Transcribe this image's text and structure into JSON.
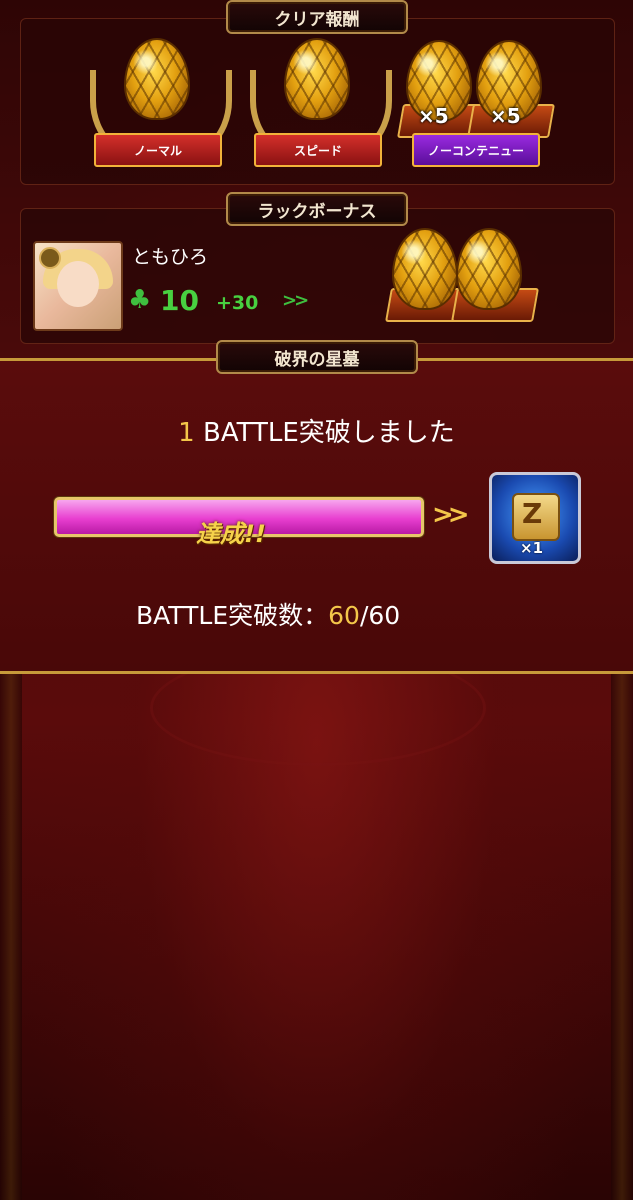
{
  "clear_reward": {
    "title": "クリア報酬",
    "ribbons": [
      {
        "label": "ノーマル"
      },
      {
        "label": "スピード"
      },
      {
        "label": "ノーコンテニュー"
      }
    ],
    "multipliers": [
      "×5",
      "×5"
    ]
  },
  "luck_bonus": {
    "title": "ラックボーナス",
    "player_name": "ともひろ",
    "luck_value": "10",
    "luck_plus": "+30",
    "arrows": ">>"
  },
  "mission": {
    "title": "破界の星墓",
    "message_count": "1",
    "message_text": " BATTLE突破しました",
    "progress_fraction": 1.0,
    "progress_label": "達成!!",
    "arrows": ">>",
    "reward_item": {
      "icon": "scroll-icon",
      "glyph": "Z",
      "count": "×1"
    },
    "battle_count_label": "BATTLE突破数：",
    "battle_current": "60",
    "battle_max": "/60"
  },
  "colors": {
    "gold": "#f3c64a",
    "luck_green": "#48d040",
    "progress_pink": "#e83fd0",
    "ribbon_red": "#d4302a",
    "ribbon_purple": "#9a2ae0"
  }
}
